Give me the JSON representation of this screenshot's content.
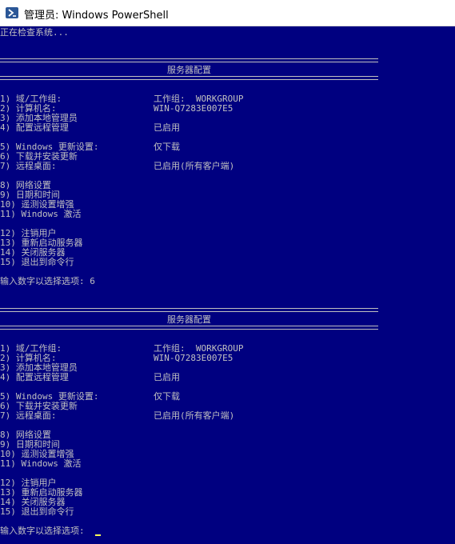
{
  "window": {
    "title": "管理员: Windows PowerShell"
  },
  "checking": "正在检查系统...",
  "blocks": [
    {
      "header": "服务器配置",
      "items": [
        "1) 域/工作组:",
        "2) 计算机名:",
        "3) 添加本地管理员",
        "4) 配置远程管理",
        "5) Windows 更新设置:",
        "6) 下载并安装更新",
        "7) 远程桌面:",
        "8) 网络设置",
        "9) 日期和时间",
        "10) 遥测设置增强",
        "11) Windows 激活",
        "12) 注销用户",
        "13) 重新启动服务器",
        "14) 关闭服务器",
        "15) 退出到命令行"
      ],
      "values": {
        "workgroup": "工作组:  WORKGROUP",
        "computer": "WIN-Q7283E007E5",
        "remote_mgmt": "已启用",
        "update": "仅下载",
        "rdp": "已启用(所有客户端)"
      },
      "prompt": "输入数字以选择选项: 6"
    },
    {
      "header": "服务器配置",
      "items": [
        "1) 域/工作组:",
        "2) 计算机名:",
        "3) 添加本地管理员",
        "4) 配置远程管理",
        "5) Windows 更新设置:",
        "6) 下载并安装更新",
        "7) 远程桌面:",
        "8) 网络设置",
        "9) 日期和时间",
        "10) 遥测设置增强",
        "11) Windows 激活",
        "12) 注销用户",
        "13) 重新启动服务器",
        "14) 关闭服务器",
        "15) 退出到命令行"
      ],
      "values": {
        "workgroup": "工作组:  WORKGROUP",
        "computer": "WIN-Q7283E007E5",
        "remote_mgmt": "已启用",
        "update": "仅下载",
        "rdp": "已启用(所有客户端)"
      },
      "prompt": "输入数字以选择选项:"
    }
  ]
}
